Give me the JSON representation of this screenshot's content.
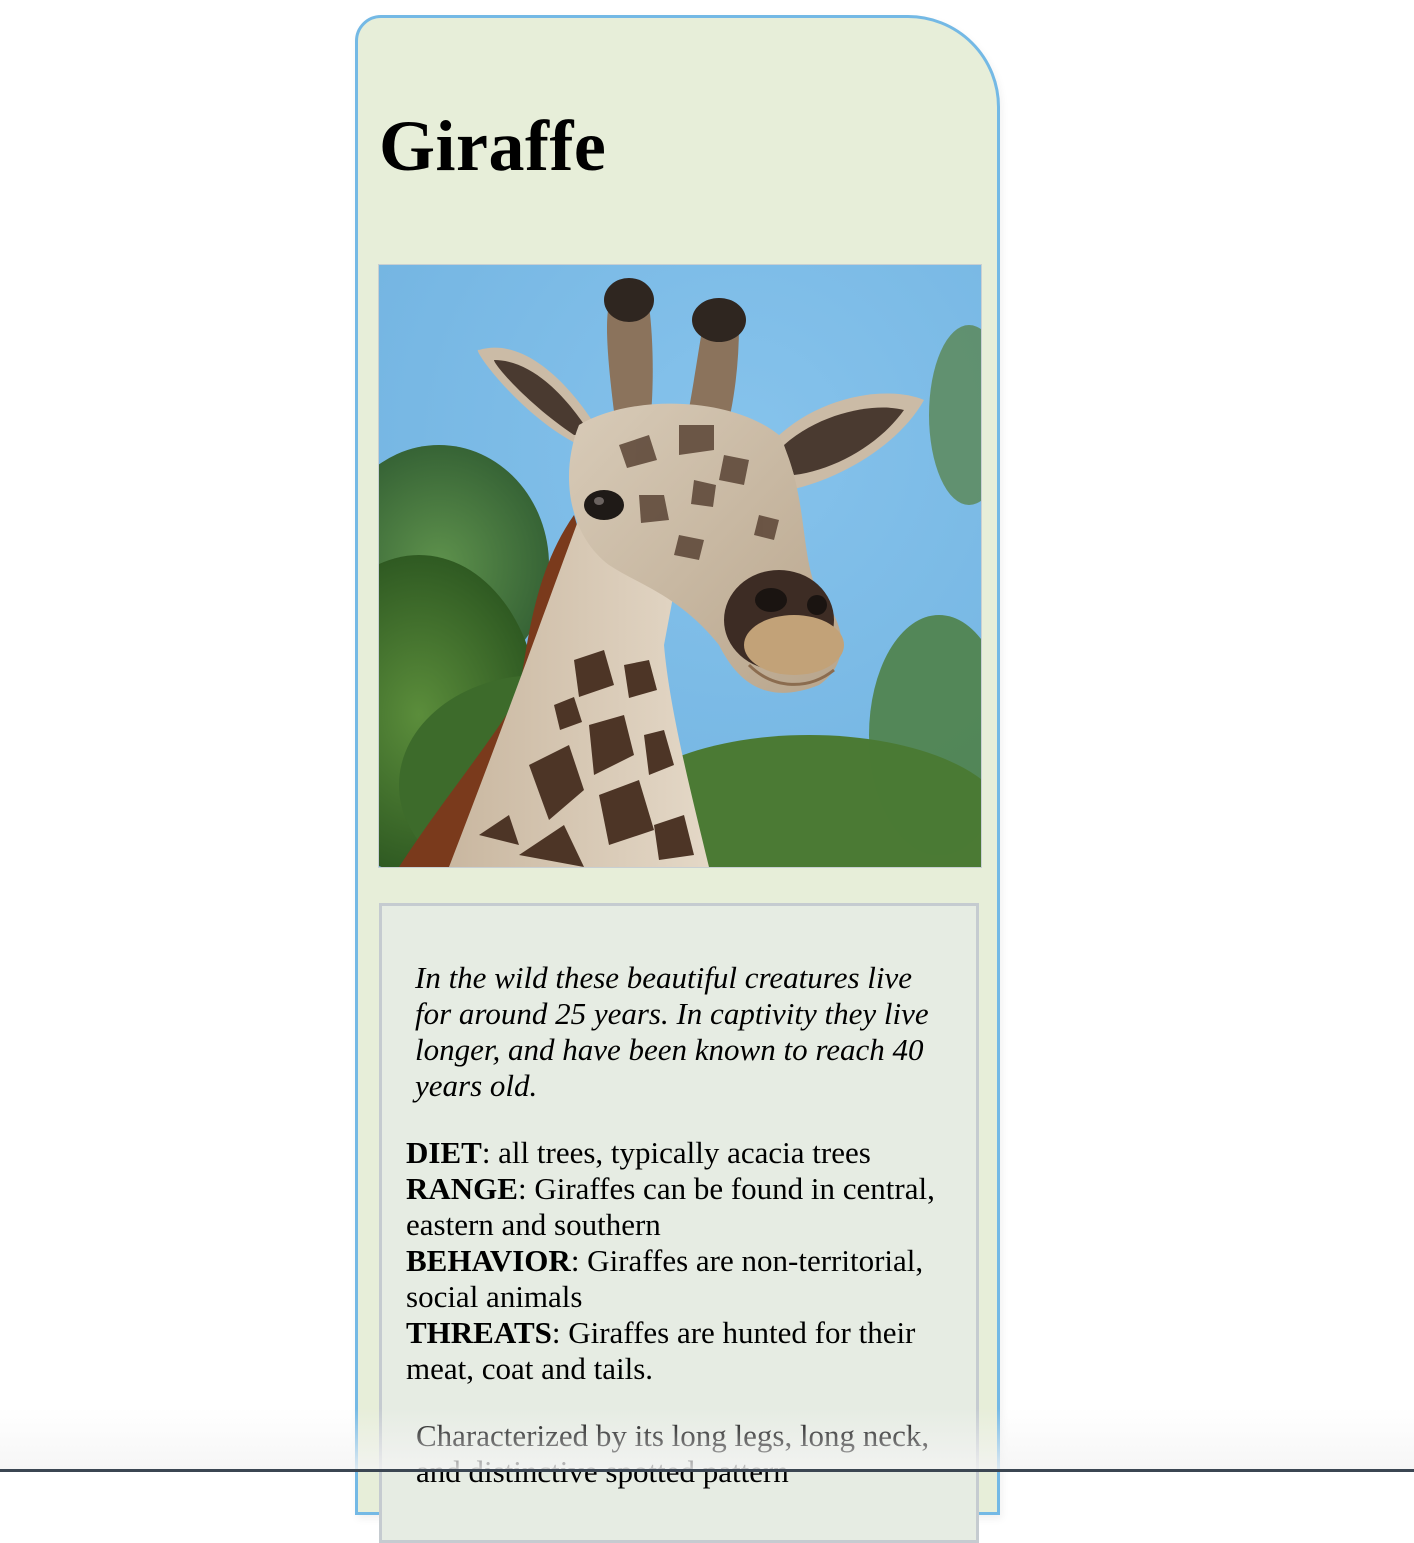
{
  "animal": {
    "name": "Giraffe",
    "photo_alt": "Giraffe"
  },
  "lifespan_text": "In the wild these beautiful creatures live for around 25 years. In captivity they live longer, and have been known to reach 40 years old.",
  "facts": [
    {
      "label": "DIET",
      "text": ": all trees, typically acacia trees"
    },
    {
      "label": "RANGE",
      "text": ": Giraffes can be found in central, eastern and southern"
    },
    {
      "label": "BEHAVIOR",
      "text": ": Giraffes are non-territorial, social animals"
    },
    {
      "label": "THREATS",
      "text": ": Giraffes are hunted for their meat, coat and tails."
    }
  ],
  "description": "Characterized by its long legs, long neck, and distinctive spotted pattern",
  "colors": {
    "card_background": "#e7eed9",
    "card_border": "#74b9e5",
    "info_background": "#e6ece3",
    "info_border": "#c5cbd0"
  }
}
